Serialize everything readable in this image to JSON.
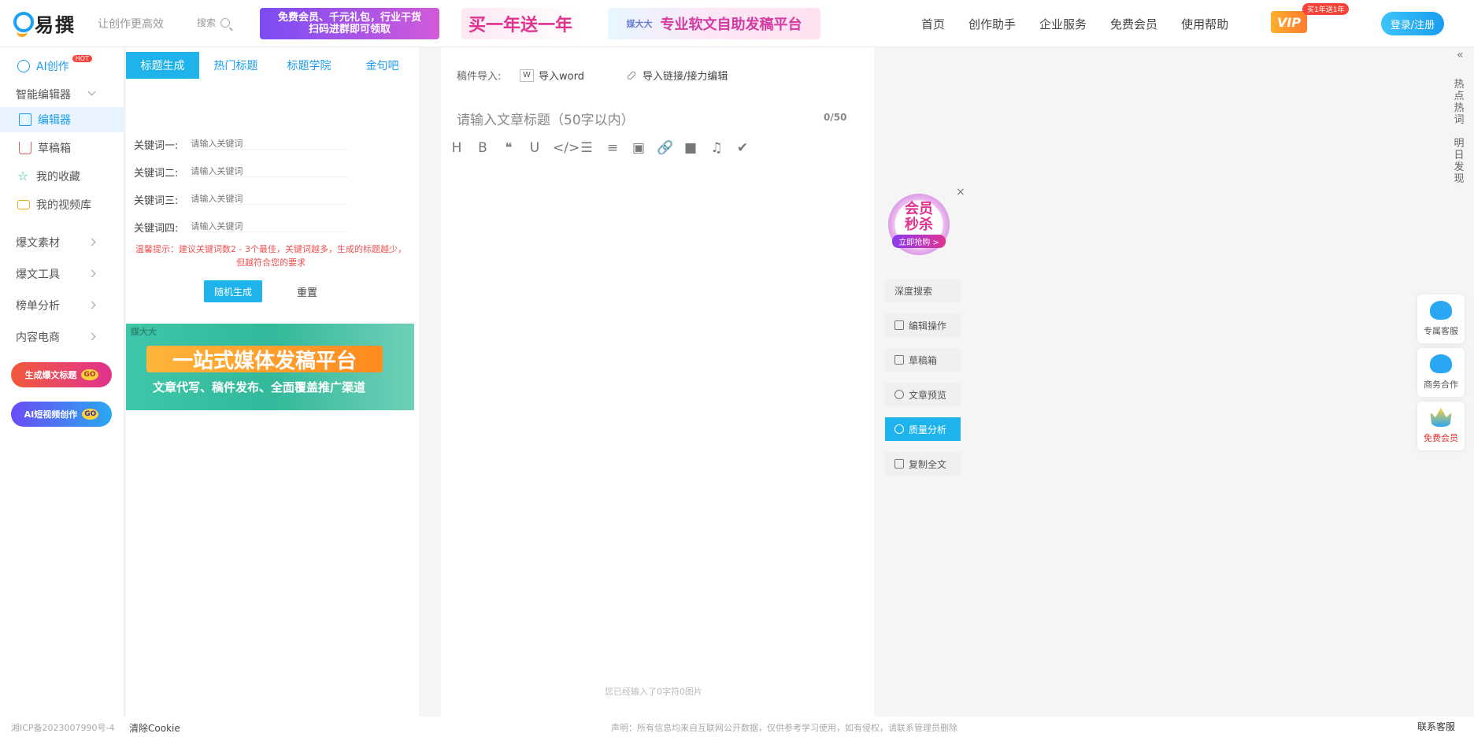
{
  "header": {
    "brand": "易撰",
    "slogan": "让创作更高效",
    "search_label": "搜索",
    "banner1_line1": "免费会员、千元礼包，行业干货",
    "banner1_line2": "扫码进群即可领取",
    "banner2": "买一年送一年",
    "banner3_tag": "媒大大",
    "banner3": "专业软文自助发稿平台",
    "nav": [
      "首页",
      "创作助手",
      "企业服务",
      "免费会员",
      "使用帮助"
    ],
    "vip": "VIP",
    "vip_badge": "买1年送1年",
    "login": "登录/注册"
  },
  "sidebar": {
    "ai_create": "AI创作",
    "hot": "HOT",
    "smart_editor": "智能编辑器",
    "editor": "编辑器",
    "drafts": "草稿箱",
    "favorites": "我的收藏",
    "video_library": "我的视频库",
    "material": "爆文素材",
    "tools": "爆文工具",
    "ranking": "榜单分析",
    "ecommerce": "内容电商",
    "promo1": "生成爆文标题",
    "promo1_go": "GO",
    "promo2": "AI短视频创作",
    "promo2_go": "GO"
  },
  "title_panel": {
    "tabs": [
      "标题生成",
      "热门标题",
      "标题学院",
      "金句吧"
    ],
    "keywords": [
      {
        "label": "关键词一:",
        "placeholder": "请输入关键词"
      },
      {
        "label": "关键词二:",
        "placeholder": "请输入关键词"
      },
      {
        "label": "关键词三:",
        "placeholder": "请输入关键词"
      },
      {
        "label": "关键词四:",
        "placeholder": "请输入关键词"
      }
    ],
    "tip": "温馨提示：建议关键词数2 - 3个最佳，关键词越多，生成的标题越少，但越符合您的要求",
    "generate": "随机生成",
    "reset": "重置",
    "ad_brand": "媒大大",
    "ad_line1": "一站式媒体发稿平台",
    "ad_line2": "文章代写、稿件发布、全面覆盖推广渠道"
  },
  "editor": {
    "import_label": "稿件导入:",
    "word_icon": "W",
    "import_word": "导入word",
    "import_link": "导入链接/接力编辑",
    "title_placeholder": "请输入文章标题（50字以内）",
    "title_count": "0/50",
    "toolbar": [
      "H",
      "B",
      "❝",
      "U",
      "</>",
      "☰",
      "≡",
      "▣",
      "🔗",
      "■",
      "♫",
      "✔"
    ],
    "word_count": "您已经输入了0字符0图片"
  },
  "right_panel": {
    "seckill_line1": "会员",
    "seckill_line2": "秒杀",
    "seckill_cta": "立即抢购 >",
    "close": "×",
    "tools": [
      "深度搜索",
      "编辑操作",
      "草稿箱",
      "文章预览",
      "质量分析",
      "复制全文"
    ],
    "hot_words": "热点热词",
    "daily": "明日发现",
    "collapse": "«"
  },
  "floating": {
    "service": "专属客服",
    "business": "商务合作",
    "member": "免费会员"
  },
  "footer": {
    "icp": "湘ICP备2023007990号-4",
    "clear_cookie": "清除Cookie",
    "disclaimer": "声明：所有信息均来自互联网公开数据，仅供参考学习使用，如有侵权，请联系管理员删除",
    "contact": "联系客服"
  },
  "colors": {
    "accent": "#1eb3ea",
    "tip": "#f05050"
  }
}
